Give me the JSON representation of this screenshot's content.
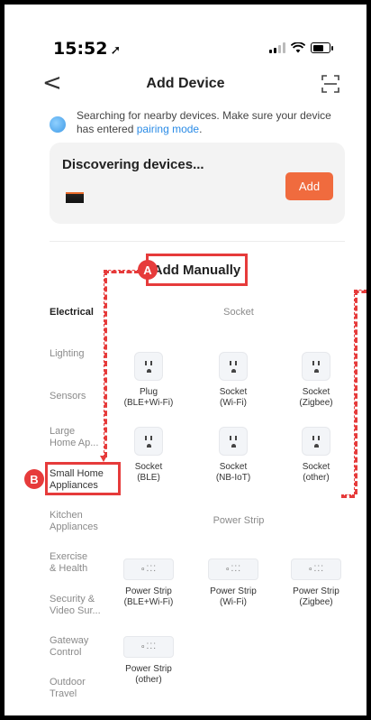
{
  "status_bar": {
    "time": "15:52",
    "location_arrow": "location-arrow-icon"
  },
  "nav": {
    "back": "<",
    "title": "Add Device"
  },
  "search_hint": {
    "text": "Searching for nearby devices. Make sure your device has entered ",
    "link": "pairing mode",
    "suffix": "."
  },
  "discovering": {
    "label": "Discovering devices...",
    "add_label": "Add"
  },
  "add_manually": "Add Manually",
  "markers": {
    "a": "A",
    "b": "B"
  },
  "categories": [
    "Electrical",
    "Lighting",
    "Sensors",
    "Large Home Ap...",
    "Small Home Appliances",
    "Kitchen Appliances",
    "Exercise & Health",
    "Security & Video Sur...",
    "Gateway Control",
    "Outdoor Travel"
  ],
  "category_lines": [
    [
      "Electrical"
    ],
    [
      "Lighting"
    ],
    [
      "Sensors"
    ],
    [
      "Large",
      "Home Ap..."
    ],
    [
      "Small Home",
      "Appliances"
    ],
    [
      "Kitchen",
      "Appliances"
    ],
    [
      "Exercise",
      "& Health"
    ],
    [
      "Security &",
      "Video Sur..."
    ],
    [
      "Gateway",
      "Control"
    ],
    [
      "Outdoor",
      "Travel"
    ]
  ],
  "sections": {
    "socket": {
      "title": "Socket",
      "items": [
        {
          "l1": "Plug",
          "l2": "(BLE+Wi-Fi)"
        },
        {
          "l1": "Socket",
          "l2": "(Wi-Fi)"
        },
        {
          "l1": "Socket",
          "l2": "(Zigbee)"
        },
        {
          "l1": "Socket",
          "l2": "(BLE)"
        },
        {
          "l1": "Socket",
          "l2": "(NB-IoT)"
        },
        {
          "l1": "Socket",
          "l2": "(other)"
        }
      ]
    },
    "power_strip": {
      "title": "Power Strip",
      "items": [
        {
          "l1": "Power Strip",
          "l2": "(BLE+Wi-Fi)"
        },
        {
          "l1": "Power Strip",
          "l2": "(Wi-Fi)"
        },
        {
          "l1": "Power Strip",
          "l2": "(Zigbee)"
        },
        {
          "l1": "Power Strip",
          "l2": "(other)"
        }
      ]
    }
  },
  "colors": {
    "accent": "#f06b3e",
    "annotation": "#e63b3b",
    "link": "#2a8be6"
  }
}
